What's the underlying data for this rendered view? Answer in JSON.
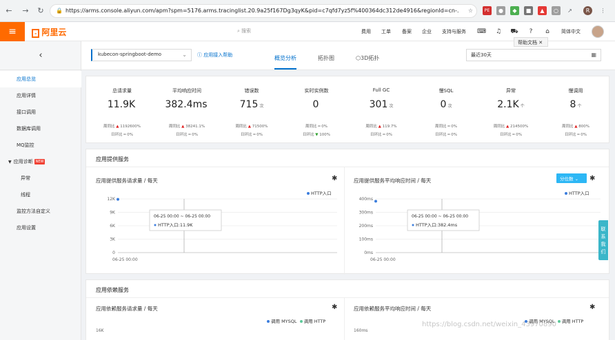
{
  "browser": {
    "url": "https://arms.console.aliyun.com/apm?spm=5176.arms.tracinglist.20.9a25f167Dg3qyK&pid=c7qfd7yz5f%400364dc312de4916&regionId=cn-…"
  },
  "topbar": {
    "logo": "阿里云",
    "search_placeholder": "搜索",
    "nav": [
      "费用",
      "工单",
      "备案",
      "企业",
      "支持与服务"
    ],
    "lang": "简体中文",
    "tooltip": "帮助文档"
  },
  "sidebar": {
    "items": [
      {
        "label": "应用总览",
        "active": true
      },
      {
        "label": "应用详情"
      },
      {
        "label": "接口调用"
      },
      {
        "label": "数据库调用"
      },
      {
        "label": "MQ监控"
      },
      {
        "label": "应用诊断",
        "badge": "NEW"
      },
      {
        "label": "异常",
        "sub": true
      },
      {
        "label": "线程",
        "sub": true
      },
      {
        "label": "监控方法自定义"
      },
      {
        "label": "应用设置"
      }
    ]
  },
  "header": {
    "app_name": "kubecon-springboot-demo",
    "help_link": "应用接入帮助",
    "tabs": [
      "概览分析",
      "拓扑图",
      "3D拓扑"
    ],
    "date_range": "最近30天"
  },
  "metrics": [
    {
      "label": "总请求量",
      "value": "11.9K",
      "unit": "",
      "week": "1192600%",
      "week_dir": "up",
      "day": "0%",
      "day_dir": "flat"
    },
    {
      "label": "平均响应时间",
      "value": "382.4ms",
      "unit": "",
      "week": "38241.1%",
      "week_dir": "up",
      "day": "0%",
      "day_dir": "flat"
    },
    {
      "label": "错误数",
      "value": "715",
      "unit": "次",
      "week": "71500%",
      "week_dir": "up",
      "day": "0%",
      "day_dir": "flat"
    },
    {
      "label": "实时实例数",
      "value": "0",
      "unit": "",
      "week": "0%",
      "week_dir": "flat",
      "day": "100%",
      "day_dir": "down"
    },
    {
      "label": "Full GC",
      "value": "301",
      "unit": "次",
      "week": "119.7%",
      "week_dir": "up",
      "day": "0%",
      "day_dir": "flat"
    },
    {
      "label": "慢SQL",
      "value": "0",
      "unit": "次",
      "week": "0%",
      "week_dir": "flat",
      "day": "0%",
      "day_dir": "flat"
    },
    {
      "label": "异常",
      "value": "2.1K",
      "unit": "个",
      "week": "214500%",
      "week_dir": "up",
      "day": "0%",
      "day_dir": "flat"
    },
    {
      "label": "慢调用",
      "value": "8",
      "unit": "个",
      "week": "800%",
      "week_dir": "up",
      "day": "0%",
      "day_dir": "flat"
    }
  ],
  "labels": {
    "week_prefix": "周同比",
    "day_prefix": "日环比"
  },
  "sections": {
    "provide_title": "应用提供服务",
    "provide_chart1_title": "应用提供服务请求量 / 每天",
    "provide_chart2_title": "应用提供服务平均响应时间 / 每天",
    "percentile_btn": "分位数",
    "depend_title": "应用依赖服务",
    "depend_chart1_title": "应用依赖服务请求量 / 每天",
    "depend_chart2_title": "应用依赖服务平均响应时间 / 每天",
    "legend_http": "HTTP入口",
    "legend_mysql": "调用 MYSQL",
    "legend_http_call": "调用 HTTP"
  },
  "chart_data": [
    {
      "type": "line",
      "title": "应用提供服务请求量 / 每天",
      "x": [
        "06-25 00:00"
      ],
      "series": [
        {
          "name": "HTTP入口",
          "values": [
            11900
          ]
        }
      ],
      "y_ticks": [
        "0",
        "3K",
        "6K",
        "9K",
        "12K"
      ],
      "ylim": [
        0,
        12000
      ],
      "tooltip_range": "06-25 00:00 ~ 06-25 00:00",
      "tooltip_value": "HTTP入口:11.9K"
    },
    {
      "type": "line",
      "title": "应用提供服务平均响应时间 / 每天",
      "x": [
        "06-25 00:00"
      ],
      "series": [
        {
          "name": "HTTP入口",
          "values": [
            382.4
          ]
        }
      ],
      "y_ticks": [
        "0ms",
        "100ms",
        "200ms",
        "300ms",
        "400ms"
      ],
      "ylim": [
        0,
        400
      ],
      "tooltip_range": "06-25 00:00 ~ 06-25 00:00",
      "tooltip_value": "HTTP入口:382.4ms"
    }
  ],
  "float_tab": "联系我们",
  "watermark": "https://blog.csdn.net/weixin_43970890",
  "colors": {
    "accent": "#0070cc",
    "brand": "#ff6a00",
    "series": "#3b7ddd"
  }
}
